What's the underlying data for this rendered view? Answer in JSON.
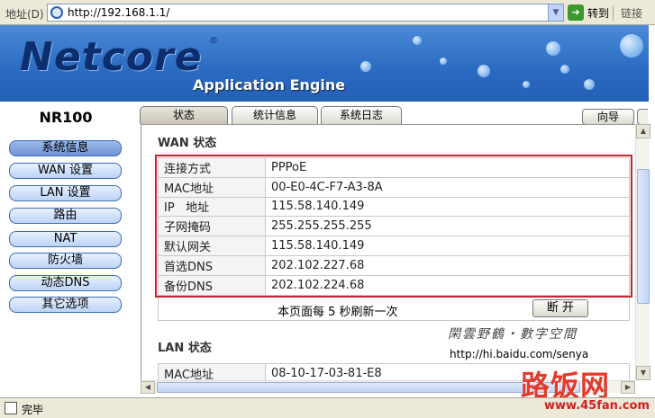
{
  "browser": {
    "address_label": "地址(D)",
    "url": "http://192.168.1.1/",
    "go_label": "转到",
    "links_label": "链接",
    "status_text": "完毕"
  },
  "banner": {
    "logo_text": "Netcore",
    "tagline": "Application Engine"
  },
  "sidebar": {
    "model": "NR100",
    "items": [
      {
        "label": "系统信息",
        "active": true
      },
      {
        "label": "WAN 设置"
      },
      {
        "label": "LAN 设置"
      },
      {
        "label": "路由"
      },
      {
        "label": "NAT"
      },
      {
        "label": "防火墙"
      },
      {
        "label": "动态DNS"
      },
      {
        "label": "其它选项"
      }
    ]
  },
  "tabs": [
    {
      "label": "状态",
      "active": true
    },
    {
      "label": "统计信息"
    },
    {
      "label": "系统日志"
    }
  ],
  "nav_button": "向导",
  "wan": {
    "title": "WAN 状态",
    "rows": [
      {
        "key": "连接方式",
        "value": "PPPoE"
      },
      {
        "key": "MAC地址",
        "value": "00-E0-4C-F7-A3-8A"
      },
      {
        "key": "IP   地址",
        "value": "115.58.140.149"
      },
      {
        "key": "子网掩码",
        "value": "255.255.255.255"
      },
      {
        "key": "默认网关",
        "value": "115.58.140.149"
      },
      {
        "key": "首选DNS",
        "value": "202.102.227.68"
      },
      {
        "key": "备份DNS",
        "value": "202.102.224.68"
      }
    ],
    "refresh_text": "本页面每 5 秒刷新一次",
    "disconnect_label": "断 开"
  },
  "signature": {
    "line1": "閑雲野鶴・數字空間",
    "line2": "http://hi.baidu.com/senya"
  },
  "lan": {
    "title": "LAN 状态",
    "rows": [
      {
        "key": "MAC地址",
        "value": "08-10-17-03-81-E8"
      }
    ]
  },
  "watermark": {
    "text": "路饭网",
    "url": "www.45fan.com"
  },
  "colors": {
    "highlight_border": "#c0282e",
    "banner_blue": "#2a6ac0"
  }
}
